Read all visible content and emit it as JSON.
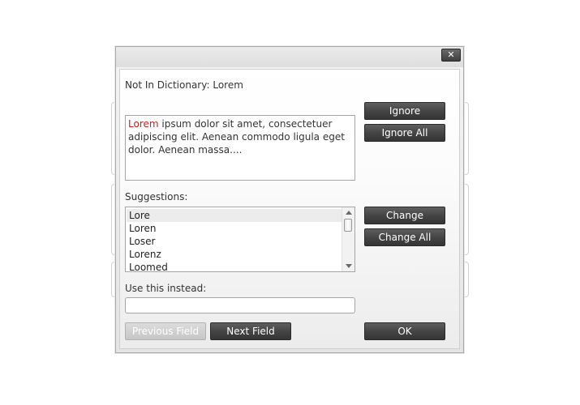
{
  "dialog": {
    "close_label": "✕",
    "not_in_dictionary_label": "Not In Dictionary:",
    "not_in_dictionary_word": "Lorem",
    "text_highlight": "Lorem",
    "text_rest": " ipsum dolor sit amet, consectetuer adipiscing elit. Aenean commodo ligula eget dolor. Aenean massa....",
    "suggestions_label": "Suggestions:",
    "suggestions": [
      "Lore",
      "Loren",
      "Loser",
      "Lorenz",
      "Loomed"
    ],
    "selected_suggestion": "Lore",
    "use_instead_label": "Use this instead:",
    "use_instead_value": "",
    "buttons": {
      "ignore": "Ignore",
      "ignore_all": "Ignore All",
      "change": "Change",
      "change_all": "Change All",
      "previous_field": "Previous Field",
      "next_field": "Next Field",
      "ok": "OK"
    }
  },
  "icons": {
    "close": "close-icon",
    "scroll_up": "chevron-up-icon",
    "scroll_down": "chevron-down-icon"
  }
}
